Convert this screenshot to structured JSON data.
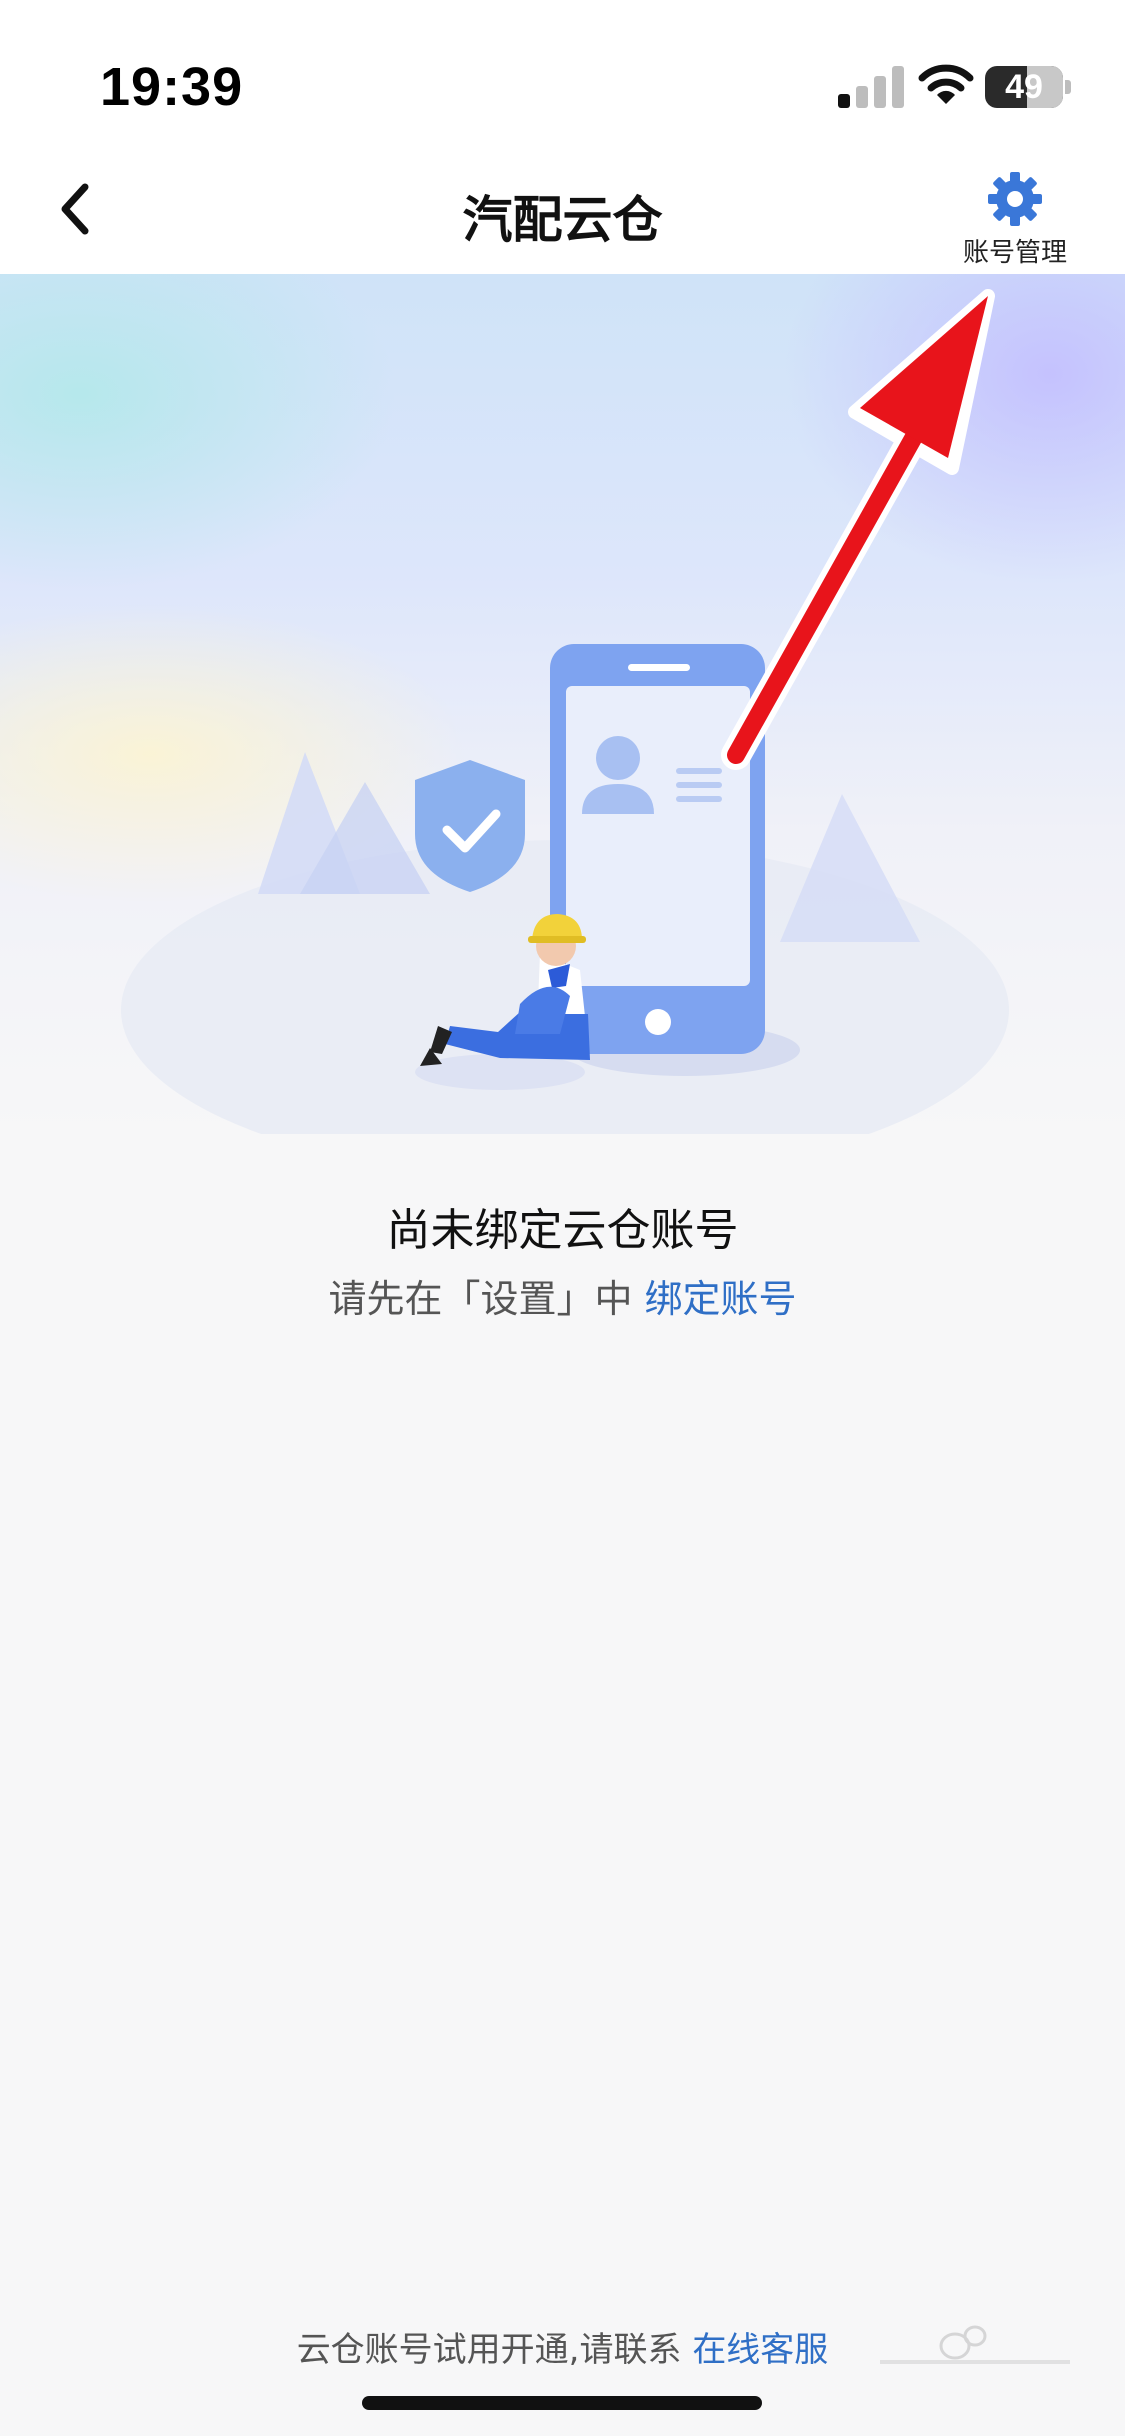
{
  "status_bar": {
    "time": "19:39",
    "battery": "49"
  },
  "nav": {
    "title": "汽配云仓",
    "back_icon": "chevron-left-icon",
    "account_management_label": "账号管理",
    "account_management_icon": "gear-icon"
  },
  "empty_state": {
    "title": "尚未绑定云仓账号",
    "hint_prefix": "请先在「设置」中 ",
    "hint_link": "绑定账号"
  },
  "footer": {
    "text_prefix": "云仓账号试用开通,请联系 ",
    "text_link": "在线客服"
  },
  "colors": {
    "accent": "#2f6fc6",
    "illustration_blue": "#7ea3f0",
    "annotation_arrow": "#e8141b"
  }
}
